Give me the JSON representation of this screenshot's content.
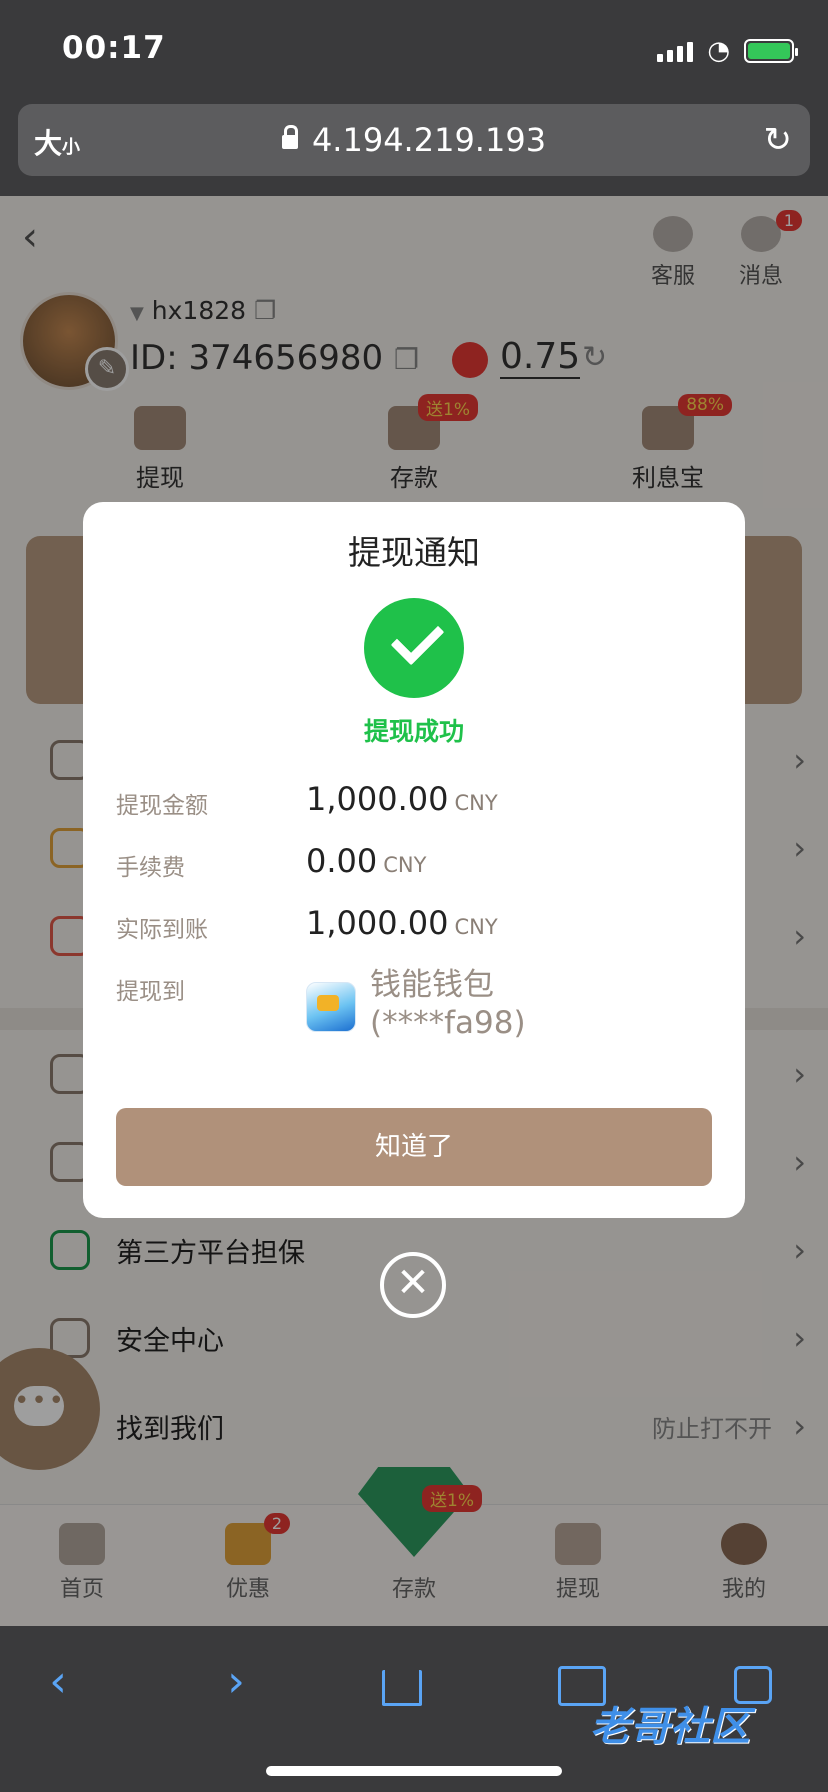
{
  "status_bar": {
    "time": "00:17"
  },
  "address_bar": {
    "text_size": "大",
    "text_size_small": "小",
    "url": "4.194.219.193"
  },
  "header": {
    "service_label": "客服",
    "messages_label": "消息",
    "messages_badge": "1"
  },
  "profile": {
    "username": "hx1828",
    "id_text": "ID: 374656980",
    "balance": "0.75"
  },
  "quick_actions": [
    {
      "label": "提现",
      "tag": ""
    },
    {
      "label": "存款",
      "tag": "送1%"
    },
    {
      "label": "利息宝",
      "tag": "88%"
    }
  ],
  "menu": {
    "guarantee_label": "第三方平台担保",
    "security_label": "安全中心",
    "find_us_label": "找到我们",
    "find_us_hint": "防止打不开"
  },
  "tabbar": {
    "tabs": [
      {
        "label": "首页"
      },
      {
        "label": "优惠",
        "badge": "2"
      },
      {
        "label": "存款",
        "tag": "送1%"
      },
      {
        "label": "提现"
      },
      {
        "label": "我的"
      }
    ]
  },
  "modal": {
    "title": "提现通知",
    "status": "提现成功",
    "rows": [
      {
        "label": "提现金额",
        "value": "1,000.00",
        "currency": "CNY"
      },
      {
        "label": "手续费",
        "value": "0.00",
        "currency": "CNY"
      },
      {
        "label": "实际到账",
        "value": "1,000.00",
        "currency": "CNY"
      }
    ],
    "dest_label": "提现到",
    "dest_wallet": "钱能钱包",
    "dest_account": "(****fa98)",
    "ok_button": "知道了"
  },
  "watermark": "老哥社区",
  "colors": {
    "accent": "#b0917a",
    "success": "#1fc14a",
    "badge": "#e53935",
    "ios_link": "#5aa4f5"
  }
}
